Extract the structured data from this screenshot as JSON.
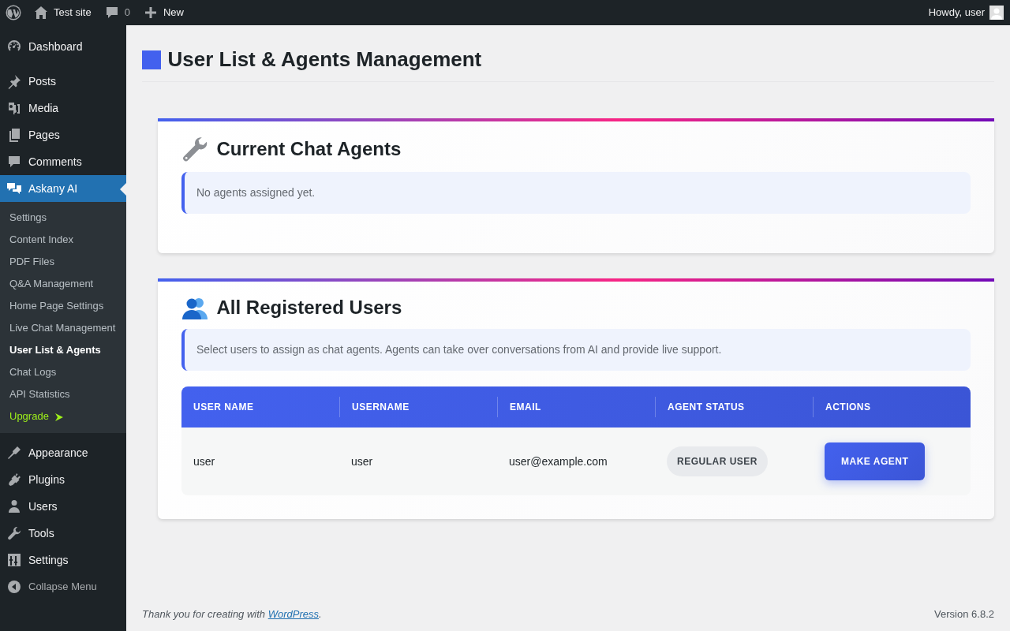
{
  "admin_bar": {
    "site": "Test site",
    "comments": "0",
    "new": "New",
    "greeting": "Howdy, user"
  },
  "menu": {
    "groups": [
      [
        {
          "label": "Dashboard",
          "selected": false
        }
      ],
      [
        {
          "label": "Posts",
          "selected": false
        },
        {
          "label": "Media",
          "selected": false
        },
        {
          "label": "Pages",
          "selected": false
        },
        {
          "label": "Comments",
          "selected": false
        },
        {
          "label": "Askany AI",
          "selected": true,
          "children": [
            {
              "label": "Settings",
              "selected": false,
              "kind": "link"
            },
            {
              "label": "Content Index",
              "selected": false,
              "kind": "link"
            },
            {
              "label": "PDF Files",
              "selected": false,
              "kind": "link"
            },
            {
              "label": "Q&A Management",
              "selected": false,
              "kind": "link"
            },
            {
              "label": "Home Page Settings",
              "selected": false,
              "kind": "link"
            },
            {
              "label": "Live Chat Management",
              "selected": false,
              "kind": "link"
            },
            {
              "label": "User List & Agents",
              "selected": true,
              "kind": "link"
            },
            {
              "label": "Chat Logs",
              "selected": false,
              "kind": "link"
            },
            {
              "label": "API Statistics",
              "selected": false,
              "kind": "link"
            },
            {
              "label": "Upgrade",
              "selected": false,
              "kind": "upgrade"
            }
          ]
        }
      ],
      [
        {
          "label": "Appearance",
          "selected": false
        },
        {
          "label": "Plugins",
          "selected": false
        },
        {
          "label": "Users",
          "selected": false
        },
        {
          "label": "Tools",
          "selected": false
        },
        {
          "label": "Settings",
          "selected": false
        }
      ]
    ],
    "collapse": "Collapse Menu"
  },
  "page": {
    "title": "User List & Agents Management",
    "sections": [
      {
        "kind": "agents",
        "title": "Current Chat Agents",
        "notice": "No agents assigned yet."
      },
      {
        "kind": "users",
        "title": "All Registered Users",
        "notice": "Select users to assign as chat agents. Agents can take over conversations from AI and provide live support.",
        "table": {
          "columns": [
            "USER NAME",
            "USERNAME",
            "EMAIL",
            "AGENT STATUS",
            "ACTIONS"
          ],
          "rows": [
            {
              "cells": [
                "user",
                "user",
                "user@example.com"
              ],
              "status": "REGULAR USER",
              "action": "MAKE AGENT"
            }
          ]
        }
      }
    ]
  },
  "footer": {
    "before": "Thank you for creating with ",
    "link": "WordPress",
    "after": ".",
    "version": "Version 6.8.2"
  }
}
